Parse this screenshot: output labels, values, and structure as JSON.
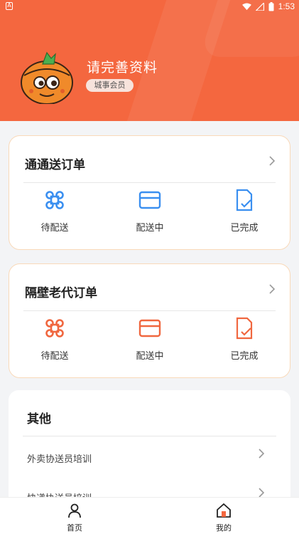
{
  "status_bar": {
    "time": "1:53",
    "left_badge": "A"
  },
  "profile": {
    "name": "请完善资料",
    "badge": "城事会员"
  },
  "orders": [
    {
      "title": "通通送订单",
      "color": "#3a8ff0",
      "items": [
        {
          "label": "待配送",
          "icon": "command-icon"
        },
        {
          "label": "配送中",
          "icon": "card-icon"
        },
        {
          "label": "已完成",
          "icon": "document-check-icon"
        }
      ]
    },
    {
      "title": "隔壁老代订单",
      "color": "#f0673f",
      "items": [
        {
          "label": "待配送",
          "icon": "command-icon"
        },
        {
          "label": "配送中",
          "icon": "card-icon"
        },
        {
          "label": "已完成",
          "icon": "document-check-icon"
        }
      ]
    }
  ],
  "other": {
    "title": "其他",
    "items": [
      "外卖协送员培训",
      "快递协送员培训"
    ]
  },
  "tabbar": {
    "items": [
      {
        "label": "首页",
        "icon": "person-icon"
      },
      {
        "label": "我的",
        "icon": "home-icon"
      }
    ]
  },
  "colors": {
    "header": "#f4673f",
    "card_border": "#f9d9b9",
    "blue": "#3a8ff0",
    "orange": "#f0673f"
  }
}
